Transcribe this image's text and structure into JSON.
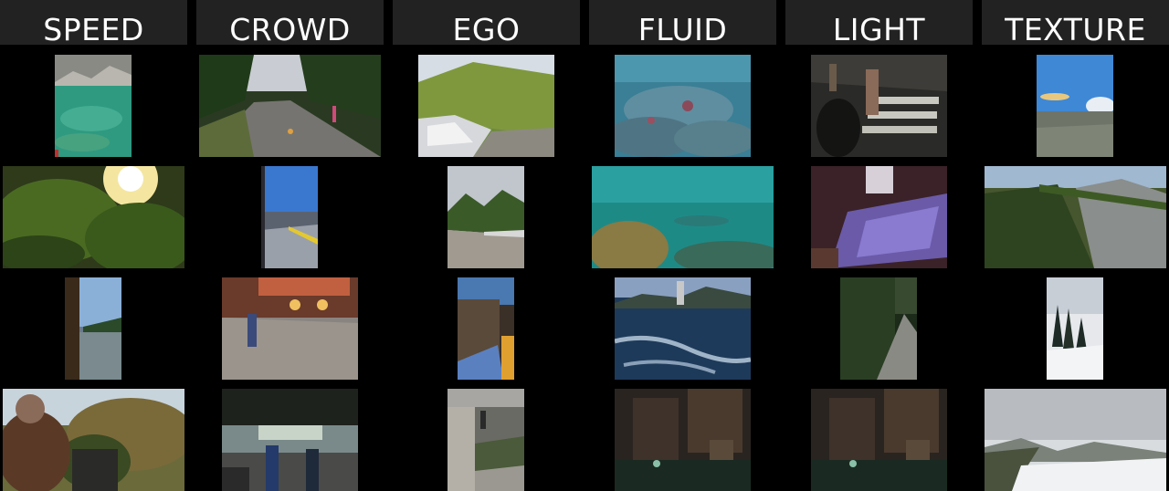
{
  "headers": [
    "SPEED",
    "CROWD",
    "EGO",
    "FLUID",
    "LIGHT",
    "TEXTURE"
  ],
  "thumbnails": {
    "speed": [
      "turquoise river with rocks",
      "sunlit green forest",
      "lakeside boardwalk",
      "rider on vehicle in dry forest"
    ],
    "crowd": [
      "tree-lined road with people",
      "crowd along railway platform",
      "street with pedestrians at dusk",
      "crowded indoor market"
    ],
    "ego": [
      "car driving on grassy hill road",
      "road beside guardrail and trees",
      "wooden fence path at night",
      "building corridor with lamp"
    ],
    "fluid": [
      "underwater coral reef",
      "underwater coral and fish",
      "choppy sea by a coastal city",
      "dark flooded cistern"
    ],
    "light": [
      "night pedestrian crosswalk",
      "reflective interior floor",
      "hedge garden walkway",
      "dark flooded cistern"
    ],
    "texture": [
      "blue sky over rocky plain",
      "pine forest on mountain slope",
      "snowy hill with pine trees",
      "snowy valley under clouds"
    ]
  }
}
